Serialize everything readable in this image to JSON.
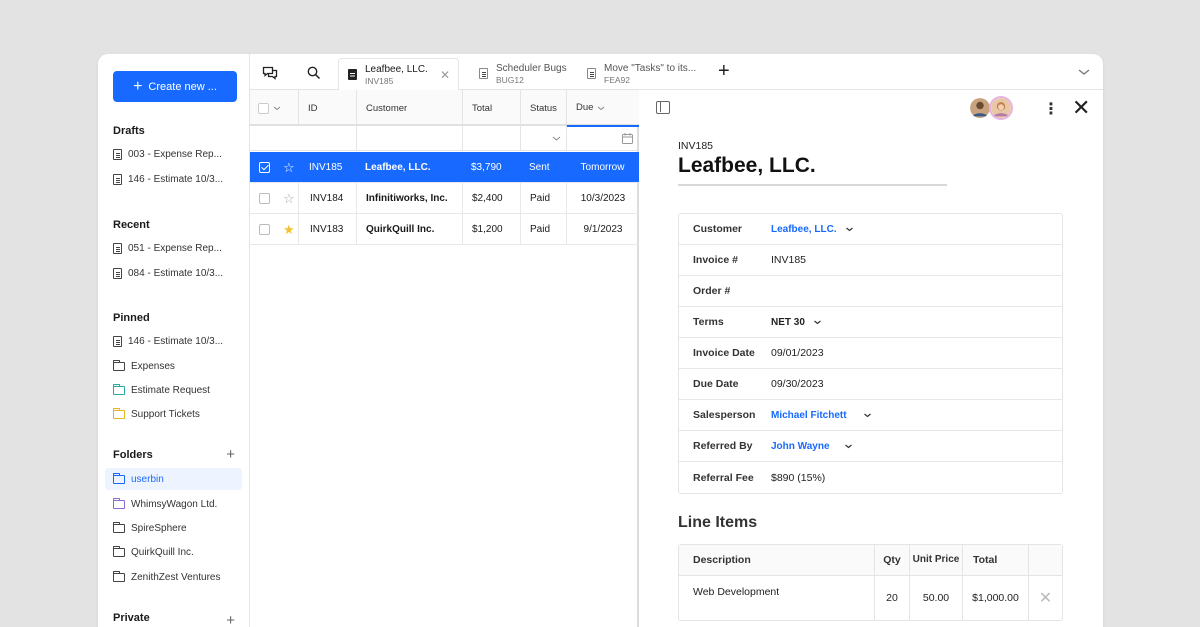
{
  "sidebar": {
    "create_label": "Create new ...",
    "drafts_title": "Drafts",
    "drafts": [
      "003 - Expense Rep...",
      "146 - Estimate 10/3..."
    ],
    "recent_title": "Recent",
    "recent": [
      "051 - Expense Rep...",
      "084 - Estimate 10/3..."
    ],
    "pinned_title": "Pinned",
    "pinned": [
      "146 - Estimate 10/3...",
      "Expenses",
      "Estimate Request",
      "Support Tickets"
    ],
    "folders_title": "Folders",
    "folders": [
      "userbin",
      "WhimsyWagon Ltd.",
      "SpireSphere",
      "QuirkQuill Inc.",
      "ZenithZest Ventures"
    ],
    "private_title": "Private"
  },
  "tabs": [
    {
      "title": "Leafbee, LLC.",
      "sub": "INV185"
    },
    {
      "title": "Scheduler Bugs",
      "sub": "BUG12"
    },
    {
      "title": "Move \"Tasks\" to its...",
      "sub": "FEA92"
    }
  ],
  "table": {
    "headers": {
      "id": "ID",
      "customer": "Customer",
      "total": "Total",
      "status": "Status",
      "due": "Due"
    },
    "rows": [
      {
        "id": "INV185",
        "customer": "Leafbee, LLC.",
        "total": "$3,790",
        "status": "Sent",
        "due": "Tomorrow"
      },
      {
        "id": "INV184",
        "customer": "Infinitiworks, Inc.",
        "total": "$2,400",
        "status": "Paid",
        "due": "10/3/2023"
      },
      {
        "id": "INV183",
        "customer": "QuirkQuill Inc.",
        "total": "$1,200",
        "status": "Paid",
        "due": "9/1/2023"
      }
    ]
  },
  "detail": {
    "id": "INV185",
    "title": "Leafbee, LLC.",
    "fields": [
      {
        "label": "Customer",
        "value": "Leafbee, LLC."
      },
      {
        "label": "Invoice #",
        "value": "INV185"
      },
      {
        "label": "Order  #",
        "value": ""
      },
      {
        "label": "Terms",
        "value": "NET 30"
      },
      {
        "label": "Invoice Date",
        "value": "09/01/2023"
      },
      {
        "label": "Due Date",
        "value": "09/30/2023"
      },
      {
        "label": "Salesperson",
        "value": "Michael Fitchett"
      },
      {
        "label": "Referred By",
        "value": "John Wayne"
      },
      {
        "label": "Referral Fee",
        "value": "$890 (15%)"
      }
    ],
    "line_items_title": "Line Items",
    "line_headers": {
      "description": "Description",
      "qty": "Qty",
      "unit_price": "Unit Price",
      "total": "Total"
    },
    "line_items": [
      {
        "description": "Web Development",
        "qty": "20",
        "unit_price": "50.00",
        "total": "$1,000.00"
      }
    ]
  },
  "colors": {
    "accent": "#1769ff",
    "star": "#f2c12e"
  }
}
